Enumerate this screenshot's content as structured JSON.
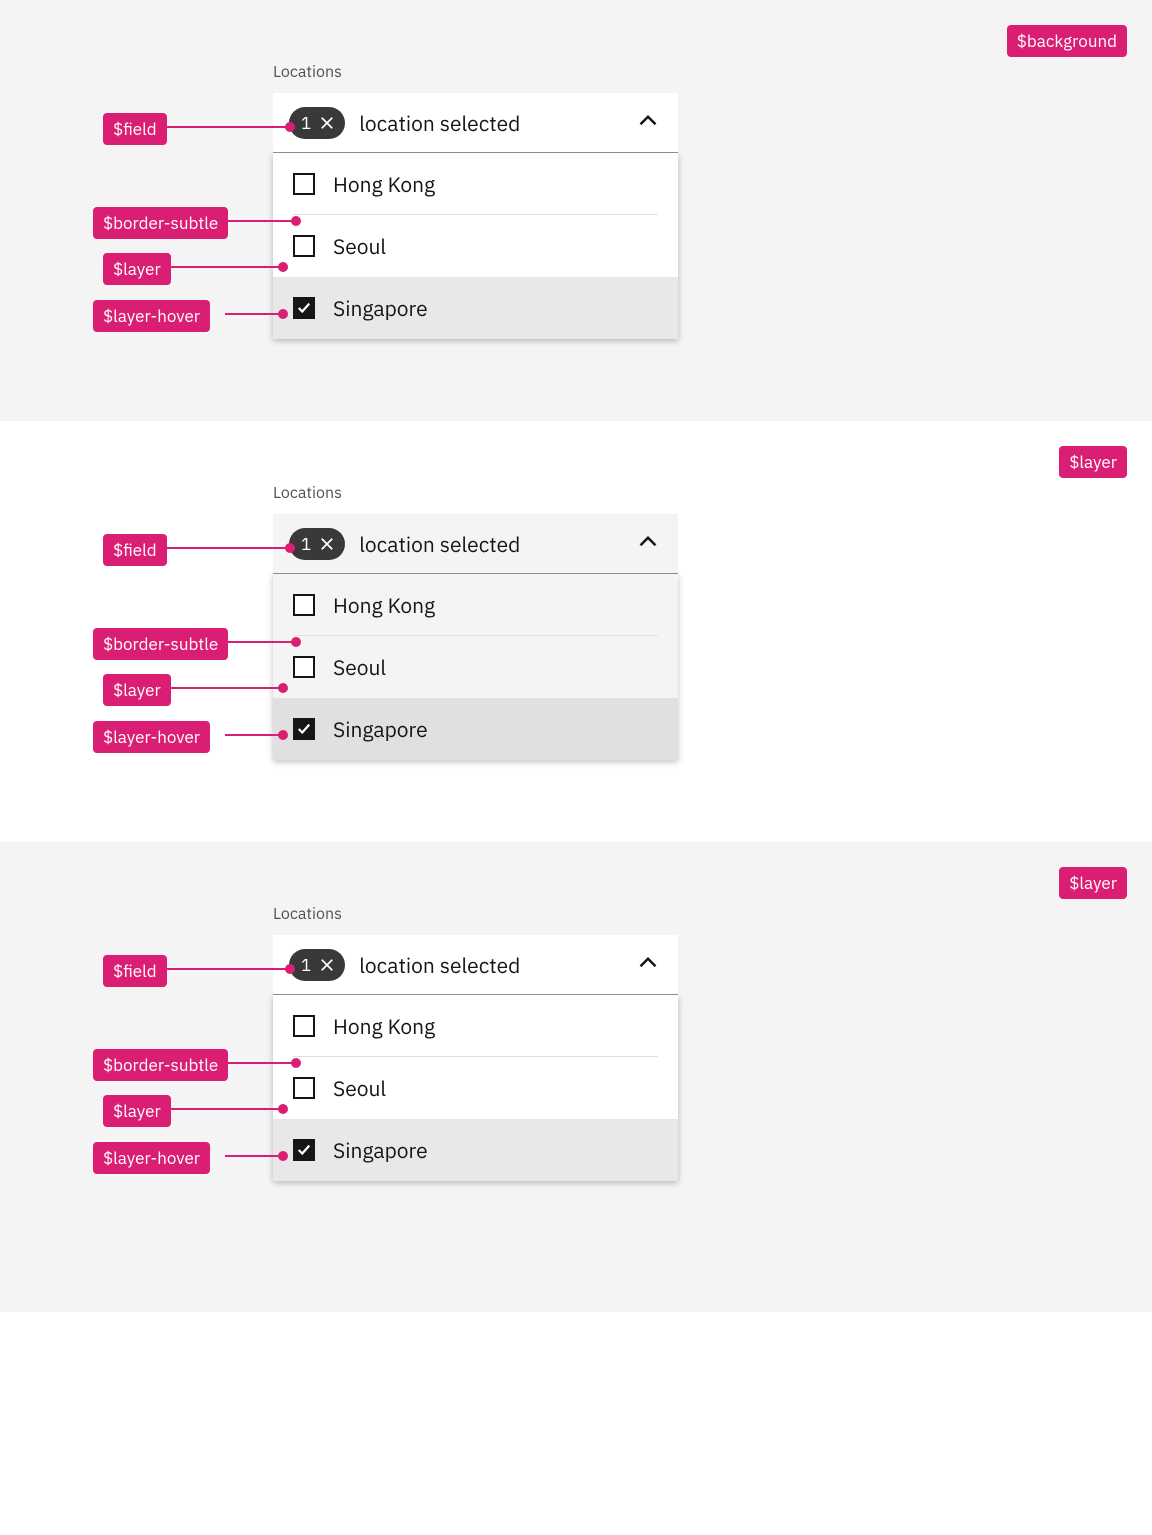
{
  "section1": {
    "context_tag": "$background",
    "label": "Locations",
    "count": "1",
    "field_text": "location selected",
    "options": [
      "Hong Kong",
      "Seoul",
      "Singapore"
    ],
    "annos": {
      "field": "$field",
      "border_subtle": "$border-subtle",
      "layer": "$layer",
      "layer_hover": "$layer-hover"
    }
  },
  "section2": {
    "context_tag": "$layer",
    "label": "Locations",
    "count": "1",
    "field_text": "location selected",
    "options": [
      "Hong Kong",
      "Seoul",
      "Singapore"
    ],
    "annos": {
      "field": "$field",
      "border_subtle": "$border-subtle",
      "layer": "$layer",
      "layer_hover": "$layer-hover"
    }
  },
  "section3": {
    "context_tag": "$layer",
    "label": "Locations",
    "count": "1",
    "field_text": "location selected",
    "options": [
      "Hong Kong",
      "Seoul",
      "Singapore"
    ],
    "annos": {
      "field": "$field",
      "border_subtle": "$border-subtle",
      "layer": "$layer",
      "layer_hover": "$layer-hover"
    }
  }
}
